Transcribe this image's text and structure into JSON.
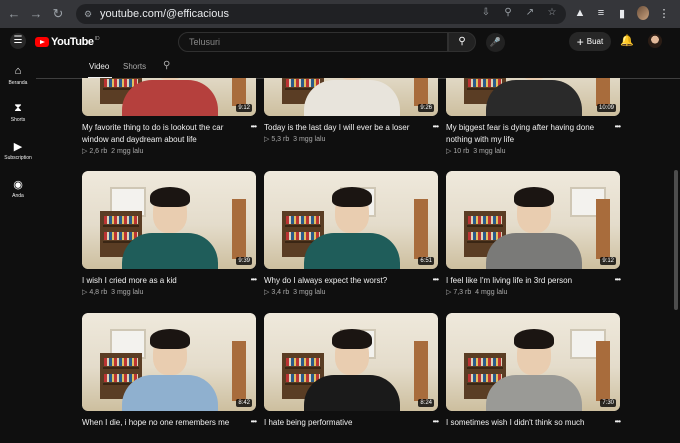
{
  "browser": {
    "url": "youtube.com/@efficacious",
    "nav": [
      "back-icon",
      "forward-icon",
      "reload-icon"
    ],
    "omnibox_icons": [
      "install-icon",
      "zoom-icon",
      "share-icon",
      "bookmark-star-icon"
    ],
    "extension_icons": [
      "extension-icon",
      "media-control-icon",
      "side-panel-icon"
    ]
  },
  "youtube": {
    "logo_text": "YouTube",
    "logo_country": "ID",
    "search_placeholder": "Telusuri",
    "create_label": "Buat"
  },
  "sidebar": {
    "items": [
      {
        "label": "Beranda",
        "icon": "home-icon"
      },
      {
        "label": "Shorts",
        "icon": "shorts-icon"
      },
      {
        "label": "Subscription",
        "icon": "subscriptions-icon"
      },
      {
        "label": "Anda",
        "icon": "you-icon"
      }
    ]
  },
  "tabs": {
    "items": [
      "Video",
      "Shorts"
    ],
    "active": "Video"
  },
  "videos": [
    {
      "title": "My favorite thing to do is lookout the car window and daydream about life",
      "views": "2,6 rb",
      "age": "2 mgg lalu",
      "duration": "9:12",
      "shirt": "#b5403d"
    },
    {
      "title": "Today is the last day I will ever be a loser",
      "views": "5,3 rb",
      "age": "3 mgg lalu",
      "duration": "9:26",
      "shirt": "#e8e4dc"
    },
    {
      "title": "My biggest fear is dying after having done nothing with my life",
      "views": "10 rb",
      "age": "3 mgg lalu",
      "duration": "10:09",
      "shirt": "#2a2a2a"
    },
    {
      "title": "I wish I cried more as a kid",
      "views": "4,8 rb",
      "age": "3 mgg lalu",
      "duration": "9:39",
      "shirt": "#1f5d5a"
    },
    {
      "title": "Why do I always expect the worst?",
      "views": "3,4 rb",
      "age": "3 mgg lalu",
      "duration": "6:51",
      "shirt": "#1f5d5a"
    },
    {
      "title": "I feel like I'm living life in 3rd person",
      "views": "7,3 rb",
      "age": "4 mgg lalu",
      "duration": "9:12",
      "shirt": "#7a7a78"
    },
    {
      "title": "When I die, i hope no one remembers me",
      "views": "",
      "age": "",
      "duration": "8:42",
      "shirt": "#8fb0cf"
    },
    {
      "title": "I hate being performative",
      "views": "",
      "age": "",
      "duration": "8:24",
      "shirt": "#1a1a1a"
    },
    {
      "title": "I sometimes wish I didn't think so much",
      "views": "",
      "age": "",
      "duration": "7:30",
      "shirt": "#9a9a96"
    }
  ],
  "colors": {
    "background": "#0f0f0f",
    "brand_red": "#ff0000",
    "text_primary": "#f1f1f1",
    "text_secondary": "#aaaaaa"
  }
}
